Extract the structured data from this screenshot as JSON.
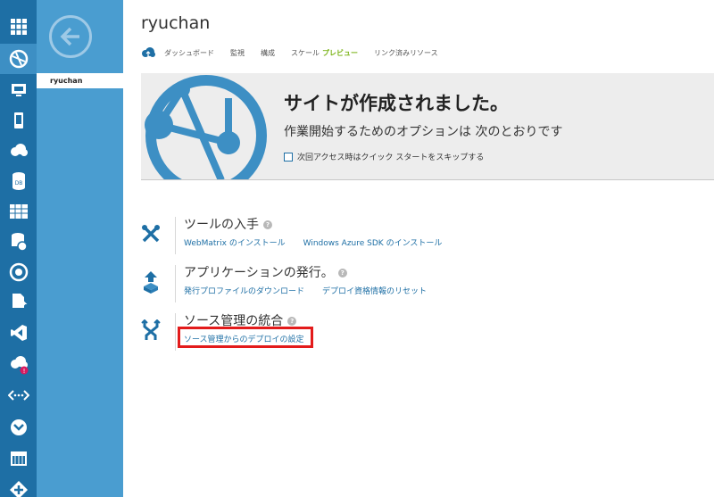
{
  "panel": {
    "item_label": "ryuchan"
  },
  "header": {
    "title": "ryuchan",
    "tabs": [
      {
        "label": "ダッシュボード"
      },
      {
        "label": "監視"
      },
      {
        "label": "構成"
      },
      {
        "label": "スケール"
      },
      {
        "label": "リンク済みリソース"
      }
    ],
    "preview_badge": "プレビュー"
  },
  "banner": {
    "title": "サイトが作成されました。",
    "subtitle": "作業開始するためのオプションは 次のとおりです",
    "skip_label": "次回アクセス時はクイック スタートをスキップする"
  },
  "sections": [
    {
      "title": "ツールの入手",
      "links": [
        "WebMatrix のインストール",
        "Windows Azure SDK のインストール"
      ]
    },
    {
      "title": "アプリケーションの発行。",
      "links": [
        "発行プロファイルのダウンロード",
        "デプロイ資格情報のリセット"
      ]
    },
    {
      "title": "ソース管理の統合",
      "links": [
        "ソース管理からのデプロイの設定"
      ]
    }
  ],
  "rail_icons": [
    "grid-icon",
    "websites-icon",
    "virtual-machines-icon",
    "mobile-services-icon",
    "cloud-services-icon",
    "sql-databases-icon",
    "storage-icon",
    "hdinsight-icon",
    "media-services-icon",
    "service-bus-icon",
    "visual-studio-icon",
    "cache-icon",
    "networks-icon",
    "traffic-manager-icon",
    "management-services-icon",
    "add-ons-icon"
  ],
  "colors": {
    "rail": "#1e6fa5",
    "panel": "#4a9dd0",
    "link": "#1e6fa5",
    "preview": "#7ab317",
    "highlight": "#e31b1b"
  }
}
